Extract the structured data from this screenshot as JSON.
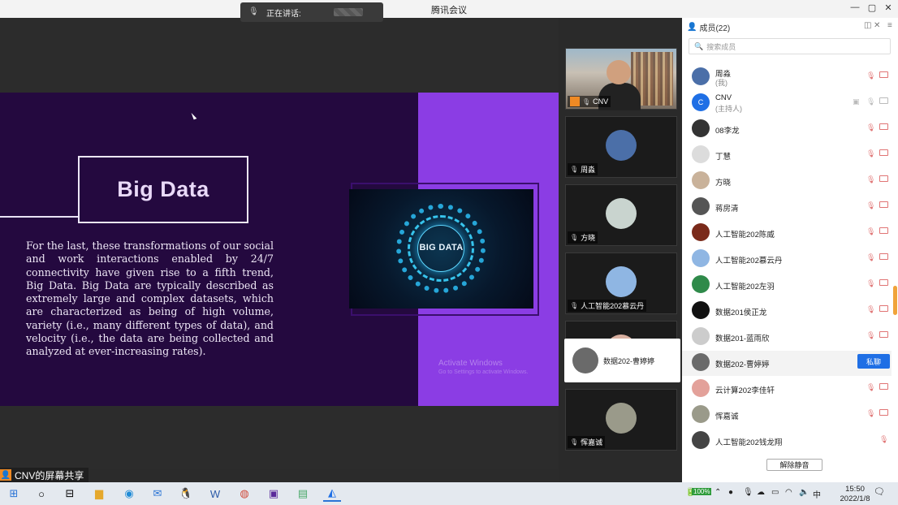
{
  "window": {
    "title": "腾讯会议",
    "speaking_label": "正在讲话:"
  },
  "slide": {
    "title": "Big Data",
    "paragraph": "For the last, these transformations of our social and work interactions enabled by 24/7 connectivity have given rise to a fifth trend, Big Data. Big Data are typically described as extremely large and complex datasets, which are characterized as being of high volume, variety (i.e., many different types of data), and velocity (i.e., the data are being collected and analyzed at ever-increasing rates).",
    "image_text": "BIG DATA",
    "watermark_line1": "Activate Windows",
    "watermark_line2": "Go to Settings to activate Windows."
  },
  "share_label": "CNV的屏幕共享",
  "video_tiles": [
    {
      "name": "CNV"
    },
    {
      "name": "周淼"
    },
    {
      "name": "方晓"
    },
    {
      "name": "人工智能202慕云丹"
    },
    {
      "name": "数据202-曹婷婷"
    },
    {
      "name": "恽嘉诚"
    }
  ],
  "members": {
    "header": "成员(22)",
    "search_placeholder": "搜索成员",
    "list": [
      {
        "name": "周淼",
        "sub": "(我)"
      },
      {
        "name": "CNV",
        "sub": "(主持人)",
        "avatar_letter": "C"
      },
      {
        "name": "08李龙"
      },
      {
        "name": "丁慧"
      },
      {
        "name": "方晓"
      },
      {
        "name": "蒋房清"
      },
      {
        "name": "人工智能202陈威"
      },
      {
        "name": "人工智能202慕云丹"
      },
      {
        "name": "人工智能202左羽"
      },
      {
        "name": "数据201侯正龙"
      },
      {
        "name": "数据201-蓝雨欣"
      },
      {
        "name": "数据202-曹婷婷"
      },
      {
        "name": "云计算202李佳轩"
      },
      {
        "name": "恽嘉诚"
      },
      {
        "name": "人工智能202钱龙翔"
      }
    ],
    "dm_button": "私聊",
    "unmute_all": "解除静音"
  },
  "taskbar": {
    "battery": "100%",
    "ime": "中",
    "time": "15:50",
    "date": "2022/1/8"
  },
  "colors": {
    "slide_bg": "#24093f",
    "slide_accent": "#8b3de4",
    "primary": "#1f6fe5"
  }
}
